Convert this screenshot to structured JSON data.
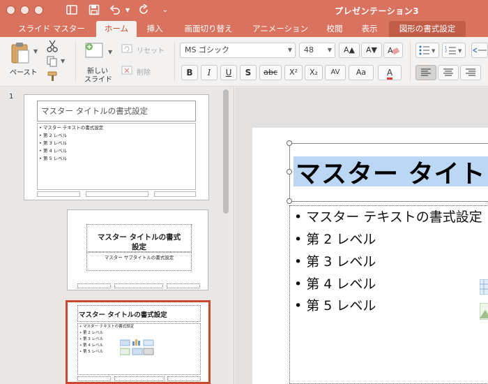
{
  "window": {
    "title": "プレゼンテーション3"
  },
  "tabs": [
    {
      "label": "スライド マスター",
      "state": "normal"
    },
    {
      "label": "ホーム",
      "state": "active"
    },
    {
      "label": "挿入",
      "state": "normal"
    },
    {
      "label": "画面切り替え",
      "state": "normal"
    },
    {
      "label": "アニメーション",
      "state": "normal"
    },
    {
      "label": "校閲",
      "state": "normal"
    },
    {
      "label": "表示",
      "state": "normal"
    },
    {
      "label": "図形の書式設定",
      "state": "contextual"
    }
  ],
  "ribbon": {
    "paste_label": "ペースト",
    "new_slide_label": "新しい\nスライド",
    "new_slide_line1": "新しい",
    "new_slide_line2": "スライド",
    "reset_label": "リセット",
    "delete_label": "削除",
    "font_name": "MS ゴシック",
    "font_size": "48",
    "format_buttons": {
      "bold": "B",
      "italic": "I",
      "underline": "U",
      "shadow": "S",
      "strikethrough": "abc",
      "superscript": "X²",
      "subscript": "X₂",
      "char_spacing": "AV",
      "change_case": "Aa",
      "font_color": "A"
    },
    "font_grow": "A▲",
    "font_shrink": "A▼"
  },
  "thumbnails": {
    "slide_number": "1",
    "master": {
      "title": "マスター タイトルの書式設定",
      "body": [
        "• マスター テキストの書式設定",
        "• 第 2 レベル",
        "• 第 3 レベル",
        "• 第 4 レベル",
        "• 第 5 レベル"
      ]
    },
    "layout1": {
      "title_line1": "マスター タイトルの書式",
      "title_line2": "設定",
      "subtitle": "マスター サブタイトルの書式設定"
    },
    "layout2": {
      "title": "マスター タイトルの書式設定",
      "body": [
        "• マスター テキストの書式設定",
        "• 第 2 レベル",
        "• 第 3 レベル",
        "• 第 4 レベル",
        "• 第 5 レベル"
      ]
    }
  },
  "slide": {
    "title": "マスター タイトルの書式設定",
    "title_visible": "マスター タイト",
    "bullets": [
      "• マスター テキストの書式設定",
      "• 第 2 レベル",
      "• 第 3 レベル",
      "• 第 4 レベル",
      "• 第 5 レベル"
    ]
  },
  "colors": {
    "titlebar": "#d9735f",
    "active_tab_text": "#c74f35",
    "selection_border": "#c84b2f",
    "text_selection": "#bcd7f3"
  }
}
